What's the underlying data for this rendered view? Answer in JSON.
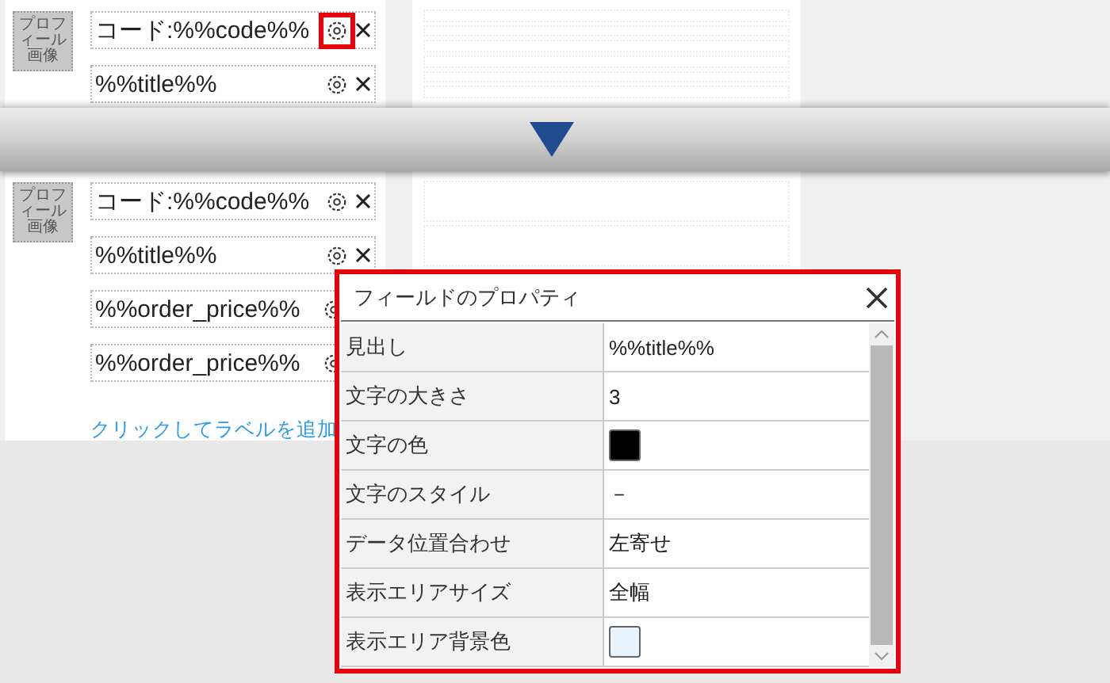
{
  "before": {
    "avatar": "プロフィール画像",
    "fields": [
      {
        "label": "コード:%%code%%",
        "highlighted": true
      },
      {
        "label": "%%title%%",
        "highlighted": false
      }
    ]
  },
  "after": {
    "avatar": "プロフィール画像",
    "fields": [
      {
        "label": "コード:%%code%%",
        "highlighted": false
      },
      {
        "label": "%%title%%",
        "highlighted": false
      },
      {
        "label": "%%order_price%%",
        "highlighted": false,
        "delete_icon": false
      },
      {
        "label": "%%order_price%%",
        "highlighted": false,
        "delete_icon": false
      }
    ],
    "add_link": "クリックしてラベルを追加"
  },
  "dialog": {
    "title": "フィールドのプロパティ",
    "rows": [
      {
        "label": "見出し",
        "kind": "text",
        "value": "%%title%%"
      },
      {
        "label": "文字の大きさ",
        "kind": "text",
        "value": "3"
      },
      {
        "label": "文字の色",
        "kind": "color",
        "color": "#000000"
      },
      {
        "label": "文字のスタイル",
        "kind": "text",
        "value": "－"
      },
      {
        "label": "データ位置合わせ",
        "kind": "text",
        "value": "左寄せ"
      },
      {
        "label": "表示エリアサイズ",
        "kind": "text",
        "value": "全幅"
      },
      {
        "label": "表示エリア背景色",
        "kind": "color",
        "color": "#e8f2fb"
      }
    ]
  }
}
